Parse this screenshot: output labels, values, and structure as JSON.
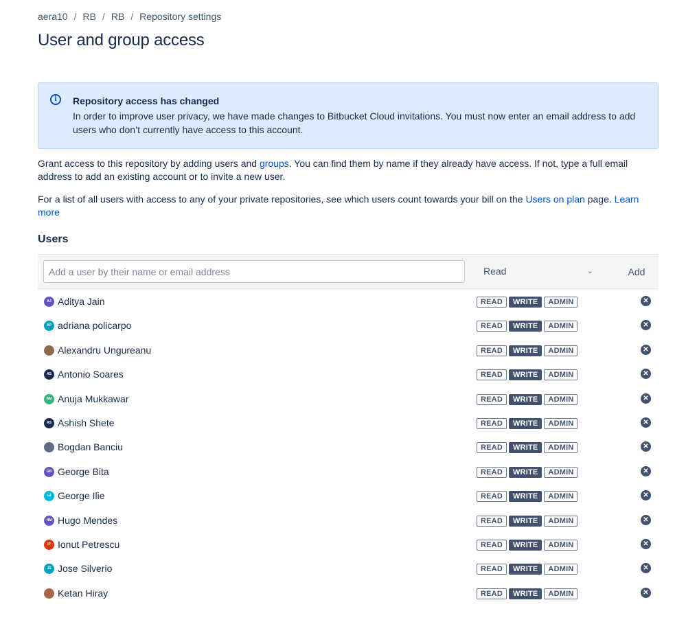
{
  "breadcrumb": [
    "aera10",
    "RB",
    "RB",
    "Repository settings"
  ],
  "page_title": "User and group access",
  "notice": {
    "title": "Repository access has changed",
    "body": "In order to improve user privacy, we have made changes to Bitbucket Cloud invitations. You must now enter an email address to add users who don’t currently have access to this account."
  },
  "intro": {
    "p1_a": "Grant access to this repository by adding users and ",
    "p1_link": "groups",
    "p1_b": ". You can find them by name if they already have access. If not, type a full email address to add an existing account or to invite a new user.",
    "p2_a": "For a list of all users with access to any of your private repositories, see which users count towards your bill on the ",
    "p2_link": "Users on plan",
    "p2_b": " page. ",
    "p2_link2": "Learn more"
  },
  "users_section": {
    "title": "Users",
    "input_placeholder": "Add a user by their name or email address",
    "permission_selected": "Read",
    "add_label": "Add"
  },
  "permission_labels": {
    "read": "READ",
    "write": "WRITE",
    "admin": "ADMIN"
  },
  "colors": {
    "accent": "#0052cc",
    "notice_bg": "#deebff",
    "active_perm": "#42526e"
  },
  "users": [
    {
      "name": "Aditya Jain",
      "initials": "AJ",
      "color": "#6554c0",
      "perm": "write"
    },
    {
      "name": "adriana policarpo",
      "initials": "AP",
      "color": "#00a3bf",
      "perm": "write"
    },
    {
      "name": "Alexandru Ungureanu",
      "initials": "",
      "color": "#8c6a4e",
      "perm": "write"
    },
    {
      "name": "Antonio Soares",
      "initials": "AS",
      "color": "#172b4d",
      "perm": "write"
    },
    {
      "name": "Anuja Mukkawar",
      "initials": "AM",
      "color": "#36b37e",
      "perm": "write"
    },
    {
      "name": "Ashish Shete",
      "initials": "AS",
      "color": "#172b4d",
      "perm": "write"
    },
    {
      "name": "Bogdan Banciu",
      "initials": "",
      "color": "#5e6c84",
      "perm": "write"
    },
    {
      "name": "George Bita",
      "initials": "GB",
      "color": "#6554c0",
      "perm": "write"
    },
    {
      "name": "George Ilie",
      "initials": "GI",
      "color": "#00b8d9",
      "perm": "write"
    },
    {
      "name": "Hugo Mendes",
      "initials": "HM",
      "color": "#6554c0",
      "perm": "write"
    },
    {
      "name": "Ionut Petrescu",
      "initials": "IP",
      "color": "#de350b",
      "perm": "write"
    },
    {
      "name": "Jose Silverio",
      "initials": "JS",
      "color": "#00a3bf",
      "perm": "write"
    },
    {
      "name": "Ketan Hiray",
      "initials": "",
      "color": "#a5664a",
      "perm": "write"
    }
  ]
}
